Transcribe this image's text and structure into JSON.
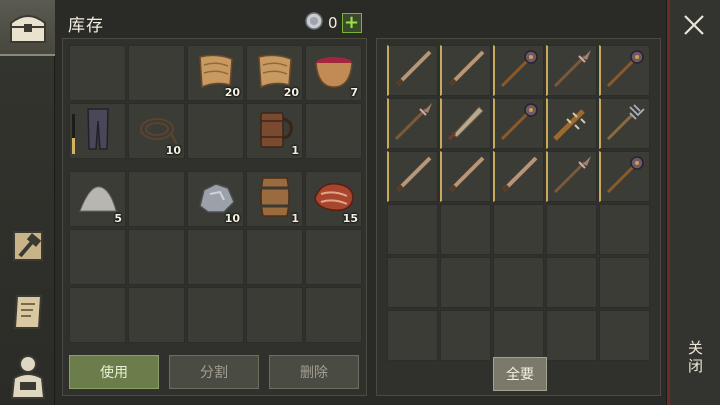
{
  "inventory": {
    "title": "库存",
    "currency": {
      "count": "0",
      "icon": "silver-coin-icon",
      "plus_label": "+"
    },
    "cells": [
      {
        "icon": "",
        "qty": ""
      },
      {
        "icon": "",
        "qty": ""
      },
      {
        "icon": "cloth-icon",
        "qty": "20"
      },
      {
        "icon": "cloth-icon",
        "qty": "20"
      },
      {
        "icon": "berry-bowl-icon",
        "qty": "7"
      },
      {
        "icon": "pants-icon",
        "qty": "",
        "durability": 0.4
      },
      {
        "icon": "rope-icon",
        "qty": "10"
      },
      {
        "icon": "",
        "qty": ""
      },
      {
        "icon": "wooden-mug-icon",
        "qty": "1"
      },
      {
        "icon": "",
        "qty": ""
      },
      {
        "icon": "sand-pile-icon",
        "qty": "5"
      },
      {
        "icon": "",
        "qty": ""
      },
      {
        "icon": "iron-ore-icon",
        "qty": "10"
      },
      {
        "icon": "barrel-icon",
        "qty": "1"
      },
      {
        "icon": "raw-meat-icon",
        "qty": "15"
      },
      {
        "icon": "",
        "qty": ""
      },
      {
        "icon": "",
        "qty": ""
      },
      {
        "icon": "",
        "qty": ""
      },
      {
        "icon": "",
        "qty": ""
      },
      {
        "icon": "",
        "qty": ""
      },
      {
        "icon": "",
        "qty": ""
      },
      {
        "icon": "",
        "qty": ""
      },
      {
        "icon": "",
        "qty": ""
      },
      {
        "icon": "",
        "qty": ""
      },
      {
        "icon": "",
        "qty": ""
      }
    ],
    "buttons": {
      "use": "使用",
      "split": "分割",
      "delete": "删除"
    }
  },
  "chest": {
    "cells": [
      {
        "icon": "sword-icon"
      },
      {
        "icon": "sword-icon"
      },
      {
        "icon": "mace-icon"
      },
      {
        "icon": "spear-icon"
      },
      {
        "icon": "mace-icon"
      },
      {
        "icon": "spear-icon"
      },
      {
        "icon": "machete-icon"
      },
      {
        "icon": "mace-icon"
      },
      {
        "icon": "spiked-club-icon"
      },
      {
        "icon": "pitchfork-icon"
      },
      {
        "icon": "sword-icon"
      },
      {
        "icon": "sword-icon"
      },
      {
        "icon": "sword-icon"
      },
      {
        "icon": "spear-icon"
      },
      {
        "icon": "mace-icon"
      },
      {
        "icon": ""
      },
      {
        "icon": ""
      },
      {
        "icon": ""
      },
      {
        "icon": ""
      },
      {
        "icon": ""
      },
      {
        "icon": ""
      },
      {
        "icon": ""
      },
      {
        "icon": ""
      },
      {
        "icon": ""
      },
      {
        "icon": ""
      },
      {
        "icon": ""
      },
      {
        "icon": ""
      },
      {
        "icon": ""
      },
      {
        "icon": ""
      },
      {
        "icon": ""
      }
    ],
    "take_all_label": "全要"
  },
  "close": {
    "label": "关闭",
    "icon": "close-icon"
  },
  "sidebar": {
    "tabs": [
      {
        "icon": "chest-icon",
        "active": true
      },
      {
        "icon": "crafting-hammer-icon",
        "active": false
      },
      {
        "icon": "blueprint-scroll-icon",
        "active": false
      },
      {
        "icon": "character-icon",
        "active": false
      }
    ]
  },
  "colors": {
    "background": "#2a2b26",
    "accent_green": "#7cb33a",
    "weapon_border": "#c9a95a"
  }
}
